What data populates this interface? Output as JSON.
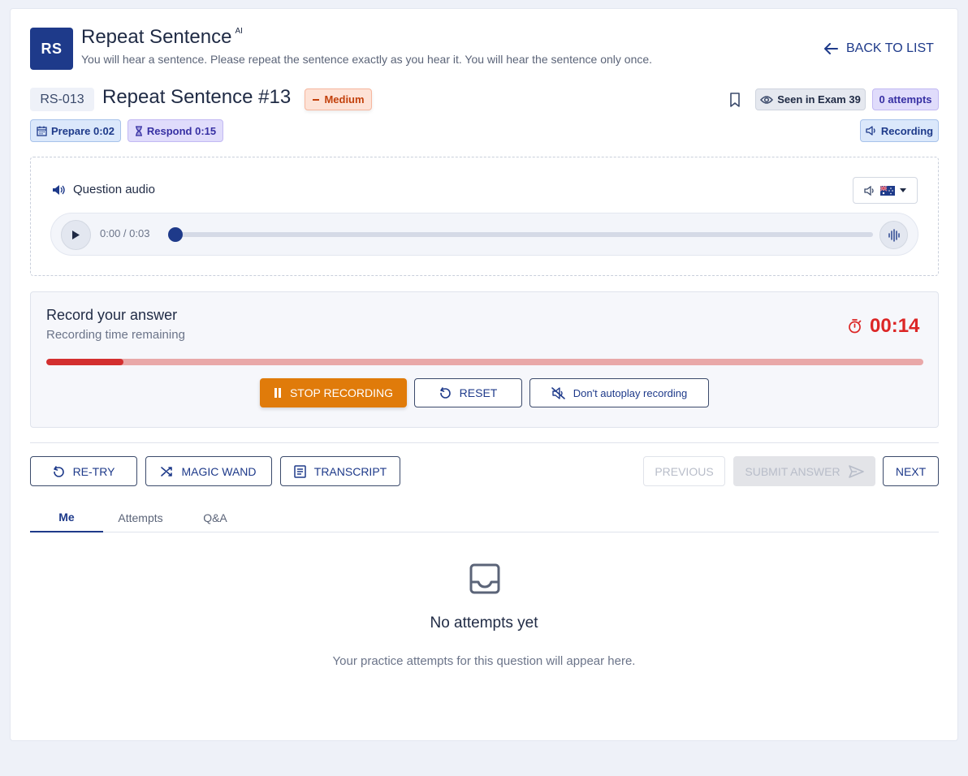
{
  "header": {
    "logo": "RS",
    "title": "Repeat Sentence",
    "title_sup": "AI",
    "subtitle": "You will hear a sentence. Please repeat the sentence exactly as you hear it. You will hear the sentence only once.",
    "back_label": "BACK TO LIST"
  },
  "question": {
    "code": "RS-013",
    "title": "Repeat Sentence #13",
    "difficulty": "Medium",
    "seen": "Seen in Exam 39",
    "attempts": "0 attempts",
    "prepare": "Prepare 0:02",
    "respond": "Respond 0:15",
    "mode": "Recording"
  },
  "audio": {
    "label": "Question audio",
    "accent": "AU",
    "time": "0:00 / 0:03",
    "progress": 0
  },
  "record": {
    "title": "Record your answer",
    "subtitle": "Recording time remaining",
    "timer": "00:14",
    "progress": 0.088,
    "stop_label": "STOP RECORDING",
    "reset_label": "RESET",
    "autoplay_label": "Don't autoplay recording"
  },
  "actions": {
    "retry": "RE-TRY",
    "wand": "MAGIC WAND",
    "transcript": "TRANSCRIPT",
    "previous": "PREVIOUS",
    "submit": "SUBMIT ANSWER",
    "next": "NEXT"
  },
  "tabs": [
    "Me",
    "Attempts",
    "Q&A"
  ],
  "empty": {
    "title": "No attempts yet",
    "text": "Your practice attempts for this question will appear here."
  },
  "colors": {
    "primary": "#1e3a8a",
    "accent_orange": "#e07b0a",
    "timer_red": "#dc2626"
  }
}
